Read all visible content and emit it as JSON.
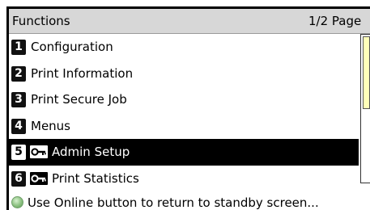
{
  "header": {
    "title": "Functions",
    "page_indicator": "1/2 Page"
  },
  "menu": {
    "items": [
      {
        "number": "1",
        "label": "Configuration",
        "locked": false,
        "selected": false
      },
      {
        "number": "2",
        "label": "Print Information",
        "locked": false,
        "selected": false
      },
      {
        "number": "3",
        "label": "Print Secure Job",
        "locked": false,
        "selected": false
      },
      {
        "number": "4",
        "label": "Menus",
        "locked": false,
        "selected": false
      },
      {
        "number": "5",
        "label": "Admin Setup",
        "locked": true,
        "selected": true
      },
      {
        "number": "6",
        "label": "Print Statistics",
        "locked": true,
        "selected": false
      }
    ]
  },
  "footer": {
    "message": "Use Online button to return to standby screen..."
  },
  "scroll": {
    "visible_fraction": 0.5,
    "offset_fraction": 0
  },
  "icons": {
    "lock": "key-icon",
    "status": "online-led-icon"
  },
  "colors": {
    "header_bg": "#d7d7d7",
    "selected_bg": "#000000",
    "scroll_thumb": "#ffffb9",
    "led": "#8bc080"
  }
}
